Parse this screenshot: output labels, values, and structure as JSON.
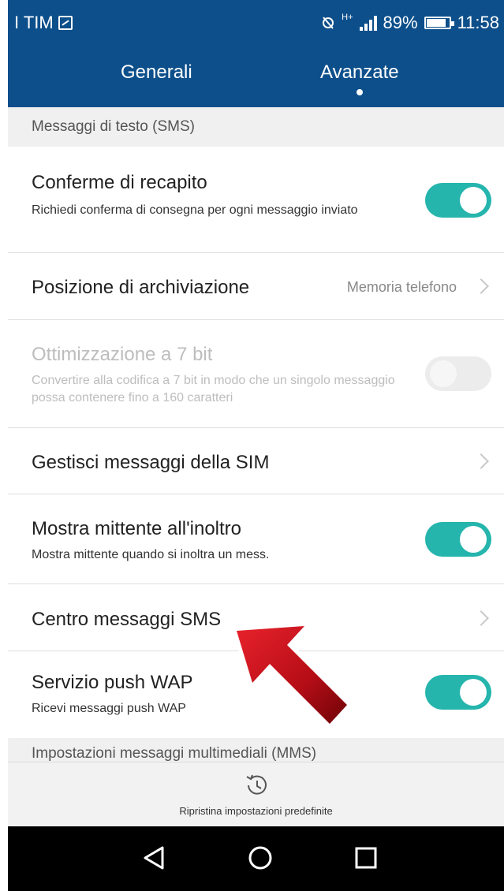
{
  "status_bar": {
    "carrier": "I TIM",
    "network": "H+",
    "battery": "89%",
    "time": "11:58"
  },
  "tabs": [
    {
      "label": "Generali",
      "active": false
    },
    {
      "label": "Avanzate",
      "active": true
    }
  ],
  "sms_section": {
    "header": "Messaggi di testo (SMS)",
    "rows": [
      {
        "title": "Conferme di recapito",
        "subtitle": "Richiedi conferma di consegna per ogni messaggio inviato",
        "toggle": true
      },
      {
        "title": "Posizione di archiviazione",
        "value": "Memoria telefono"
      },
      {
        "title": "Ottimizzazione a 7 bit",
        "subtitle": "Convertire alla codifica a 7 bit in modo che un singolo messaggio possa contenere fino a 160 caratteri",
        "toggle": false,
        "disabled": true
      },
      {
        "title": "Gestisci messaggi della SIM"
      },
      {
        "title": "Mostra mittente all'inoltro",
        "subtitle": "Mostra mittente quando si inoltra un mess.",
        "toggle": true
      },
      {
        "title": "Centro messaggi SMS"
      },
      {
        "title": "Servizio push WAP",
        "subtitle": "Ricevi messaggi push WAP",
        "toggle": true
      }
    ]
  },
  "mms_section": {
    "header": "Impostazioni messaggi multimediali (MMS)"
  },
  "bottom_action": {
    "icon": "restore-history-icon",
    "label": "Ripristina impostazioni predefinite"
  },
  "nav_bar": [
    "back-icon",
    "home-icon",
    "recent-apps-icon"
  ],
  "colors": {
    "header_blue": "#0d4f8b",
    "toggle_on": "#25b5ad",
    "arrow_red": "#c8101a"
  }
}
